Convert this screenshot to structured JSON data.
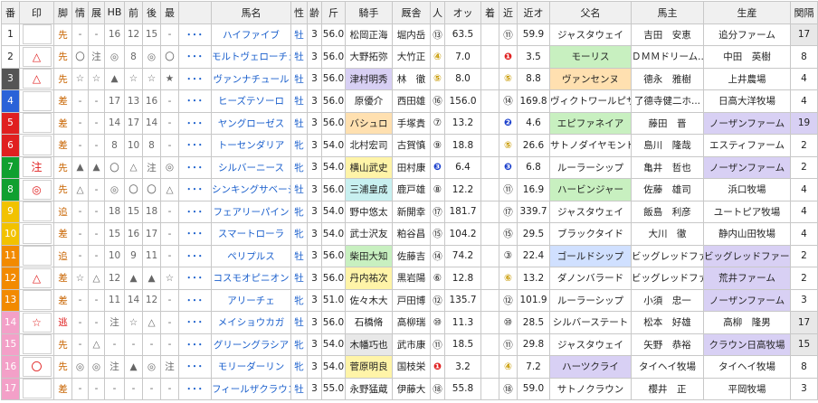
{
  "headers": [
    "番",
    "印",
    "脚",
    "情",
    "展",
    "HB",
    "前",
    "後",
    "最",
    "",
    "馬名",
    "性",
    "齢",
    "斤",
    "騎手",
    "厩舎",
    "人",
    "オッ",
    "着",
    "近",
    "近オ",
    "父名",
    "馬主",
    "生産",
    "関隔"
  ],
  "rows": [
    {
      "no": "1",
      "mark": "",
      "style": "先",
      "jo": "-",
      "ten": "-",
      "hb": "16",
      "mae": "12",
      "ato": "15",
      "sai": "-",
      "dots": "･･･",
      "name": "ハイファイブ",
      "sex": "牡",
      "age": "3",
      "kin": "56.0",
      "jockey": "松岡正海",
      "trainer": "堀内岳",
      "pop": "⑬",
      "odds": "63.5",
      "chaku": "",
      "kin2": "⑪",
      "kin_o": "59.9",
      "sire": "ジャスタウェイ",
      "owner": "吉田　安恵",
      "breeder": "追分ファーム",
      "kankaku": "17"
    },
    {
      "no": "2",
      "mark": "△",
      "style": "先",
      "jo": "〇",
      "ten": "注",
      "hb": "◎",
      "mae": "8",
      "ato": "◎",
      "sai": "〇",
      "dots": "･･･",
      "name": "モルトヴェローチェ",
      "sex": "牡",
      "age": "3",
      "kin": "56.0",
      "jockey": "大野拓弥",
      "trainer": "大竹正",
      "pop": "④",
      "odds": "7.0",
      "chaku": "",
      "kin2": "❶",
      "kin_o": "3.5",
      "sire": "モーリス",
      "owner": "ＤＭＭドリーム...",
      "breeder": "中田　英樹",
      "kankaku": "8"
    },
    {
      "no": "3",
      "mark": "△",
      "style": "先",
      "jo": "☆",
      "ten": "☆",
      "hb": "▲",
      "mae": "☆",
      "ato": "☆",
      "sai": "★",
      "dots": "･･･",
      "name": "ヴァンナチュール",
      "sex": "牡",
      "age": "3",
      "kin": "56.0",
      "jockey": "津村明秀",
      "trainer": "林　徹",
      "pop": "⑤",
      "odds": "8.0",
      "chaku": "",
      "kin2": "⑤",
      "kin_o": "8.8",
      "sire": "ヴァンセンヌ",
      "owner": "德永　雅樹",
      "breeder": "上井農場",
      "kankaku": "4"
    },
    {
      "no": "4",
      "mark": "",
      "style": "差",
      "jo": "-",
      "ten": "-",
      "hb": "17",
      "mae": "13",
      "ato": "16",
      "sai": "-",
      "dots": "･･･",
      "name": "ヒーズテソーロ",
      "sex": "牡",
      "age": "3",
      "kin": "56.0",
      "jockey": "原優介",
      "trainer": "西田雄",
      "pop": "⑯",
      "odds": "156.0",
      "chaku": "",
      "kin2": "⑭",
      "kin_o": "169.8",
      "sire": "ヴィクトワールピサ",
      "owner": "了德寺健二ホ...",
      "breeder": "日高大洋牧場",
      "kankaku": "4"
    },
    {
      "no": "5",
      "mark": "",
      "style": "差",
      "jo": "-",
      "ten": "-",
      "hb": "14",
      "mae": "17",
      "ato": "14",
      "sai": "-",
      "dots": "･･･",
      "name": "ヤングローゼス",
      "sex": "牡",
      "age": "3",
      "kin": "56.0",
      "jockey": "バシュロ",
      "trainer": "手塚貴",
      "pop": "⑦",
      "odds": "13.2",
      "chaku": "",
      "kin2": "❷",
      "kin_o": "4.6",
      "sire": "エピファネイア",
      "owner": "藤田　晋",
      "breeder": "ノーザンファーム",
      "kankaku": "19"
    },
    {
      "no": "6",
      "mark": "",
      "style": "差",
      "jo": "-",
      "ten": "-",
      "hb": "8",
      "mae": "10",
      "ato": "8",
      "sai": "-",
      "dots": "･･･",
      "name": "トーセンダリア",
      "sex": "牝",
      "age": "3",
      "kin": "54.0",
      "jockey": "北村宏司",
      "trainer": "古賀慎",
      "pop": "⑨",
      "odds": "18.8",
      "chaku": "",
      "kin2": "⑤",
      "kin_o": "26.6",
      "sire": "サトノダイヤモンド",
      "owner": "島川　隆哉",
      "breeder": "エスティファーム",
      "kankaku": "2"
    },
    {
      "no": "7",
      "mark": "注",
      "style": "先",
      "jo": "▲",
      "ten": "▲",
      "hb": "〇",
      "mae": "△",
      "ato": "注",
      "sai": "◎",
      "dots": "･･･",
      "name": "シルバーニース",
      "sex": "牝",
      "age": "3",
      "kin": "54.0",
      "jockey": "横山武史",
      "trainer": "田村康",
      "pop": "❸",
      "odds": "6.4",
      "chaku": "",
      "kin2": "❸",
      "kin_o": "6.8",
      "sire": "ルーラーシップ",
      "owner": "亀井　哲也",
      "breeder": "ノーザンファーム",
      "kankaku": "2"
    },
    {
      "no": "8",
      "mark": "◎",
      "style": "先",
      "jo": "△",
      "ten": "-",
      "hb": "◎",
      "mae": "〇",
      "ato": "〇",
      "sai": "△",
      "dots": "･･･",
      "name": "シンキングサベージ",
      "sex": "牡",
      "age": "3",
      "kin": "56.0",
      "jockey": "三浦皇成",
      "trainer": "鹿戸雄",
      "pop": "⑧",
      "odds": "12.2",
      "chaku": "",
      "kin2": "⑪",
      "kin_o": "16.9",
      "sire": "ハービンジャー",
      "owner": "佐藤　雄司",
      "breeder": "浜口牧場",
      "kankaku": "4"
    },
    {
      "no": "9",
      "mark": "",
      "style": "追",
      "jo": "-",
      "ten": "-",
      "hb": "18",
      "mae": "15",
      "ato": "18",
      "sai": "-",
      "dots": "･･･",
      "name": "フェアリーパイン",
      "sex": "牝",
      "age": "3",
      "kin": "54.0",
      "jockey": "野中悠太",
      "trainer": "新開幸",
      "pop": "⑰",
      "odds": "181.7",
      "chaku": "",
      "kin2": "⑰",
      "kin_o": "339.7",
      "sire": "ジャスタウェイ",
      "owner": "飯島　利彦",
      "breeder": "ユートピア牧場",
      "kankaku": "4"
    },
    {
      "no": "10",
      "mark": "",
      "style": "差",
      "jo": "-",
      "ten": "-",
      "hb": "15",
      "mae": "16",
      "ato": "17",
      "sai": "-",
      "dots": "･･･",
      "name": "スマートローラ",
      "sex": "牝",
      "age": "3",
      "kin": "54.0",
      "jockey": "武士沢友",
      "trainer": "粕谷昌",
      "pop": "⑮",
      "odds": "104.2",
      "chaku": "",
      "kin2": "⑮",
      "kin_o": "29.5",
      "sire": "ブラックタイド",
      "owner": "大川　徹",
      "breeder": "静内山田牧場",
      "kankaku": "4"
    },
    {
      "no": "11",
      "mark": "",
      "style": "追",
      "jo": "-",
      "ten": "-",
      "hb": "10",
      "mae": "9",
      "ato": "11",
      "sai": "-",
      "dots": "･･･",
      "name": "ペリプルス",
      "sex": "牡",
      "age": "3",
      "kin": "56.0",
      "jockey": "柴田大知",
      "trainer": "佐藤吉",
      "pop": "⑭",
      "odds": "74.2",
      "chaku": "",
      "kin2": "③",
      "kin_o": "22.4",
      "sire": "ゴールドシップ",
      "owner": "ビッグレッドファーム",
      "breeder": "ビッグレッドファーム",
      "kankaku": "2"
    },
    {
      "no": "12",
      "mark": "△",
      "style": "差",
      "jo": "☆",
      "ten": "△",
      "hb": "12",
      "mae": "▲",
      "ato": "▲",
      "sai": "☆",
      "dots": "･･･",
      "name": "コスモオピニオン",
      "sex": "牡",
      "age": "3",
      "kin": "56.0",
      "jockey": "丹内祐次",
      "trainer": "黒岩陽",
      "pop": "⑥",
      "odds": "12.8",
      "chaku": "",
      "kin2": "⑥",
      "kin_o": "13.2",
      "sire": "ダノンバラード",
      "owner": "ビッグレッドファーム",
      "breeder": "荒井ファーム",
      "kankaku": "2"
    },
    {
      "no": "13",
      "mark": "",
      "style": "差",
      "jo": "-",
      "ten": "-",
      "hb": "11",
      "mae": "14",
      "ato": "12",
      "sai": "-",
      "dots": "･･･",
      "name": "アリーチェ",
      "sex": "牝",
      "age": "3",
      "kin": "51.0",
      "jockey": "佐々木大",
      "trainer": "戸田博",
      "pop": "⑫",
      "odds": "135.7",
      "chaku": "",
      "kin2": "⑫",
      "kin_o": "101.9",
      "sire": "ルーラーシップ",
      "owner": "小須　忠一",
      "breeder": "ノーザンファーム",
      "kankaku": "3"
    },
    {
      "no": "14",
      "mark": "☆",
      "style": "逃",
      "jo": "-",
      "ten": "-",
      "hb": "注",
      "mae": "☆",
      "ato": "△",
      "sai": "-",
      "dots": "･･･",
      "name": "メイショウカガ",
      "sex": "牡",
      "age": "3",
      "kin": "56.0",
      "jockey": "石橋脩",
      "trainer": "高柳瑞",
      "pop": "⑩",
      "odds": "11.3",
      "chaku": "",
      "kin2": "⑩",
      "kin_o": "28.5",
      "sire": "シルバーステート",
      "owner": "松本　好雄",
      "breeder": "高柳　隆男",
      "kankaku": "17"
    },
    {
      "no": "15",
      "mark": "",
      "style": "先",
      "jo": "-",
      "ten": "△",
      "hb": "-",
      "mae": "-",
      "ato": "-",
      "sai": "-",
      "dots": "･･･",
      "name": "グリーングラシア",
      "sex": "牝",
      "age": "3",
      "kin": "54.0",
      "jockey": "木幡巧也",
      "trainer": "武市康",
      "pop": "⑪",
      "odds": "18.5",
      "chaku": "",
      "kin2": "⑪",
      "kin_o": "29.8",
      "sire": "ジャスタウェイ",
      "owner": "矢野　恭裕",
      "breeder": "クラウン日高牧場",
      "kankaku": "15"
    },
    {
      "no": "16",
      "mark": "〇",
      "style": "先",
      "jo": "◎",
      "ten": "◎",
      "hb": "注",
      "mae": "▲",
      "ato": "◎",
      "sai": "注",
      "dots": "･･･",
      "name": "モリーダーリン",
      "sex": "牝",
      "age": "3",
      "kin": "54.0",
      "jockey": "菅原明良",
      "trainer": "国枝栄",
      "pop": "❶",
      "odds": "3.2",
      "chaku": "",
      "kin2": "④",
      "kin_o": "7.2",
      "sire": "ハーツクライ",
      "owner": "タイヘイ牧場",
      "breeder": "タイヘイ牧場",
      "kankaku": "8"
    },
    {
      "no": "17",
      "mark": "",
      "style": "差",
      "jo": "-",
      "ten": "-",
      "hb": "-",
      "mae": "-",
      "ato": "-",
      "sai": "-",
      "dots": "･･･",
      "name": "フィールザクラウン",
      "sex": "牡",
      "age": "3",
      "kin": "55.0",
      "jockey": "永野猛蔵",
      "trainer": "伊藤大",
      "pop": "⑱",
      "odds": "55.8",
      "chaku": "",
      "kin2": "⑱",
      "kin_o": "59.0",
      "sire": "サトノクラウン",
      "owner": "櫻井　正",
      "breeder": "平岡牧場",
      "kankaku": "3"
    }
  ],
  "colors": {
    "waku": [
      "#ffffff",
      "#ffffff",
      "#555555",
      "#2a62d8",
      "#e02020",
      "#e02020",
      "#10a030",
      "#10a030",
      "#f2c200",
      "#f2c200",
      "#f28a00",
      "#f28a00",
      "#f28a00",
      "#f3a0c8",
      "#f3a0c8",
      "#f3a0c8"
    ],
    "waku_text_dark": "#222222",
    "waku_text_light": "#ffffff"
  }
}
